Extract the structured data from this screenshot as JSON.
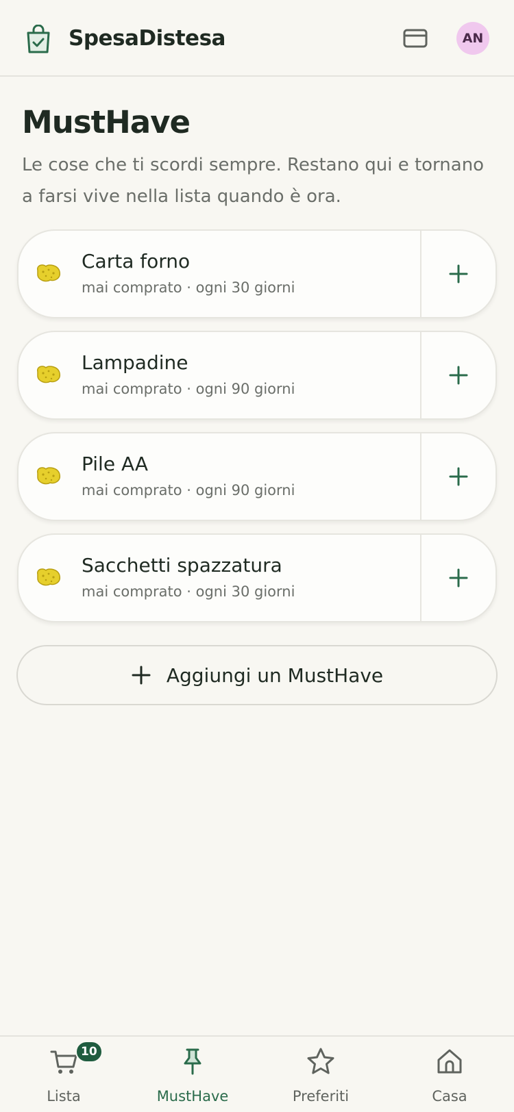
{
  "header": {
    "app_title": "SpesaDistesa",
    "logo_icon": "shopping-bag-check-icon",
    "card_icon": "credit-card-icon",
    "avatar_initials": "AN",
    "avatar_color": "#f0c8ee"
  },
  "page": {
    "title": "MustHave",
    "description": "Le cose che ti scordi sempre. Restano qui e tornano a farsi vive nella lista quando è ora."
  },
  "items": [
    {
      "emoji": "sponge-icon",
      "name": "Carta forno",
      "meta": "mai comprato · ogni 30 giorni"
    },
    {
      "emoji": "sponge-icon",
      "name": "Lampadine",
      "meta": "mai comprato · ogni 90 giorni"
    },
    {
      "emoji": "sponge-icon",
      "name": "Pile AA",
      "meta": "mai comprato · ogni 90 giorni"
    },
    {
      "emoji": "sponge-icon",
      "name": "Sacchetti spazzatura",
      "meta": "mai comprato · ogni 30 giorni"
    }
  ],
  "add_button": {
    "label": "Aggiungi un MustHave"
  },
  "nav": {
    "items": [
      {
        "label": "Lista",
        "icon": "cart-icon",
        "badge": "10"
      },
      {
        "label": "MustHave",
        "icon": "pin-icon",
        "active": true
      },
      {
        "label": "Preferiti",
        "icon": "star-icon"
      },
      {
        "label": "Casa",
        "icon": "home-icon"
      }
    ]
  },
  "colors": {
    "background": "#f8f7f2",
    "accent_green": "#2a6b4b",
    "badge_green": "#1f5c3f",
    "text_dark": "#1f2a22",
    "text_muted": "#6a6e69"
  }
}
